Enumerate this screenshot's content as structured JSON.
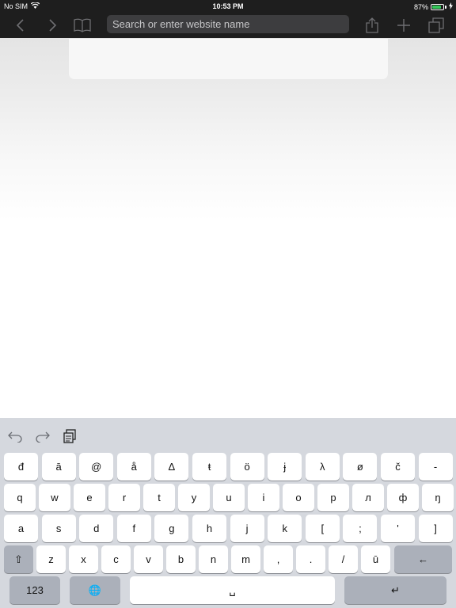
{
  "status_bar": {
    "carrier": "No SIM",
    "time": "10:53 PM",
    "battery_percent": "87%",
    "battery_level": 0.87,
    "battery_color": "#35c759"
  },
  "toolbar": {
    "address_placeholder": "Search or enter website name",
    "icons": [
      "back-icon",
      "forward-icon",
      "bookmarks-icon",
      "share-icon",
      "new-tab-icon",
      "tabs-icon"
    ]
  },
  "keyboard": {
    "shortcuts": [
      "undo-icon",
      "redo-icon",
      "paste-icon"
    ],
    "row1": [
      "đ",
      "ā",
      "@",
      "å",
      "Δ",
      "ŧ",
      "ö",
      "ɉ",
      "λ",
      "ø",
      "č",
      "-"
    ],
    "row2": [
      "q",
      "w",
      "e",
      "r",
      "t",
      "y",
      "u",
      "i",
      "o",
      "p",
      "л",
      "ф",
      "ŋ"
    ],
    "row3": [
      "a",
      "s",
      "d",
      "f",
      "g",
      "h",
      "j",
      "k",
      "[",
      ";",
      "'",
      "]"
    ],
    "row4": [
      "z",
      "x",
      "c",
      "v",
      "b",
      "n",
      "m",
      ",",
      ".",
      "/",
      "ū"
    ],
    "shift_label": "⇧",
    "backspace_label": "←",
    "numbers_label": "123",
    "globe_label": "🌐",
    "space_label": "␣",
    "return_label": "↵"
  }
}
